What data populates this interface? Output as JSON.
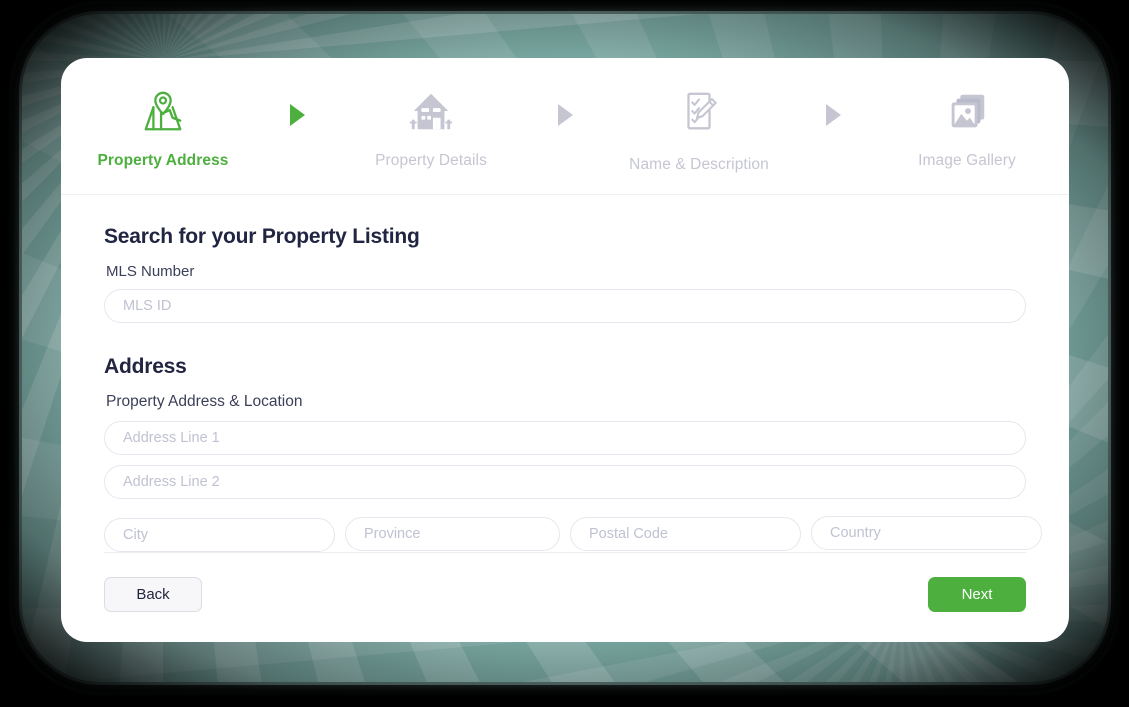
{
  "theme": {
    "accent_green": "#4CAF3E",
    "muted_gray": "#c5c6d2",
    "heading_navy": "#212541",
    "frame_teal": "#8cb5b0",
    "card_background": "#ffffff"
  },
  "stepper": {
    "steps": [
      {
        "label": "Property Address",
        "icon": "map-pin-icon",
        "state": "active"
      },
      {
        "label": "Property Details",
        "icon": "house-icon",
        "state": "inactive"
      },
      {
        "label": "Name & Description",
        "icon": "checklist-pencil-icon",
        "state": "inactive"
      },
      {
        "label": "Image Gallery",
        "icon": "image-gallery-icon",
        "state": "inactive"
      }
    ],
    "arrows": [
      {
        "icon": "arrow-right-icon",
        "state": "done"
      },
      {
        "icon": "arrow-right-icon",
        "state": "pending"
      },
      {
        "icon": "arrow-right-icon",
        "state": "pending"
      }
    ]
  },
  "search_section": {
    "title": "Search for your Property Listing",
    "mls": {
      "label": "MLS Number",
      "placeholder": "MLS ID",
      "value": ""
    }
  },
  "address_section": {
    "title": "Address",
    "subtitle": "Property Address & Location",
    "fields": {
      "address_line_1": {
        "placeholder": "Address Line 1",
        "value": ""
      },
      "address_line_2": {
        "placeholder": "Address Line 2",
        "value": ""
      },
      "city": {
        "placeholder": "City",
        "value": ""
      },
      "province": {
        "placeholder": "Province",
        "value": ""
      },
      "postal_code": {
        "placeholder": "Postal Code",
        "value": ""
      },
      "country": {
        "placeholder": "Country",
        "value": ""
      }
    }
  },
  "footer": {
    "back_label": "Back",
    "next_label": "Next"
  }
}
